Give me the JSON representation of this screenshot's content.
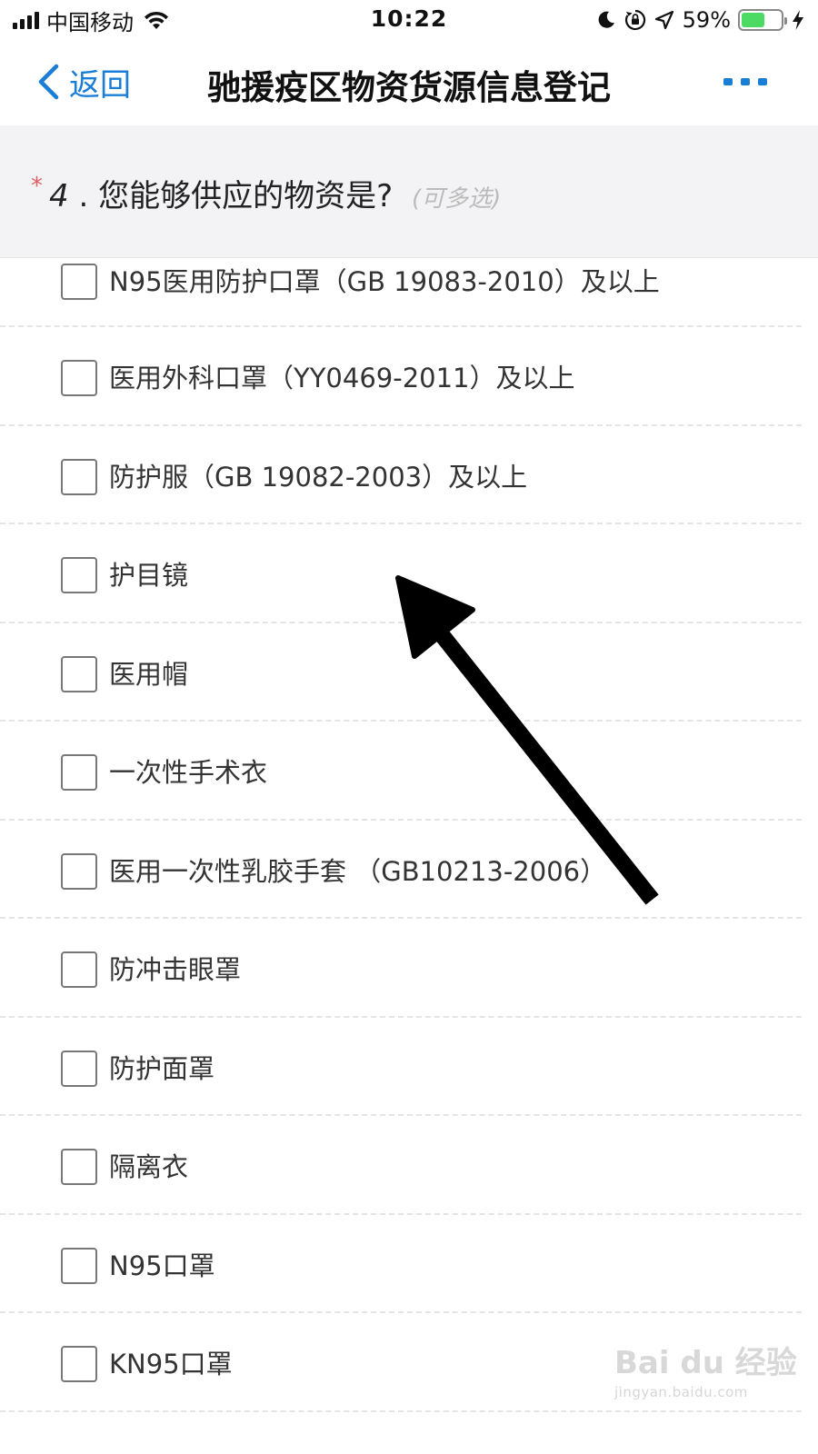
{
  "status_bar": {
    "carrier": "中国移动",
    "time": "10:22",
    "battery_percent": "59%",
    "battery_level": 0.59,
    "icons": [
      "signal-icon",
      "wifi-icon",
      "moon-icon",
      "orientation-lock-icon",
      "location-icon",
      "battery-icon",
      "charging-icon"
    ]
  },
  "nav": {
    "back_label": "返回",
    "title": "驰援疫区物资货源信息登记",
    "accent_color": "#1a7ed6"
  },
  "question": {
    "required_mark": "*",
    "number": "4",
    "separator": ".",
    "text": "您能够供应的物资是?",
    "hint": "(可多选)"
  },
  "options": [
    {
      "label": "N95医用防护口罩（GB 19083-2010）及以上",
      "checked": false
    },
    {
      "label": "医用外科口罩（YY0469-2011）及以上",
      "checked": false
    },
    {
      "label": "防护服（GB 19082-2003）及以上",
      "checked": false
    },
    {
      "label": "护目镜",
      "checked": false
    },
    {
      "label": "医用帽",
      "checked": false
    },
    {
      "label": "一次性手术衣",
      "checked": false
    },
    {
      "label": "医用一次性乳胶手套 （GB10213-2006）",
      "checked": false
    },
    {
      "label": "防冲击眼罩",
      "checked": false
    },
    {
      "label": "防护面罩",
      "checked": false
    },
    {
      "label": "隔离衣",
      "checked": false
    },
    {
      "label": "N95口罩",
      "checked": false
    },
    {
      "label": "KN95口罩",
      "checked": false
    }
  ],
  "watermark": {
    "logo": "Bai du 经验",
    "url": "jingyan.baidu.com"
  }
}
